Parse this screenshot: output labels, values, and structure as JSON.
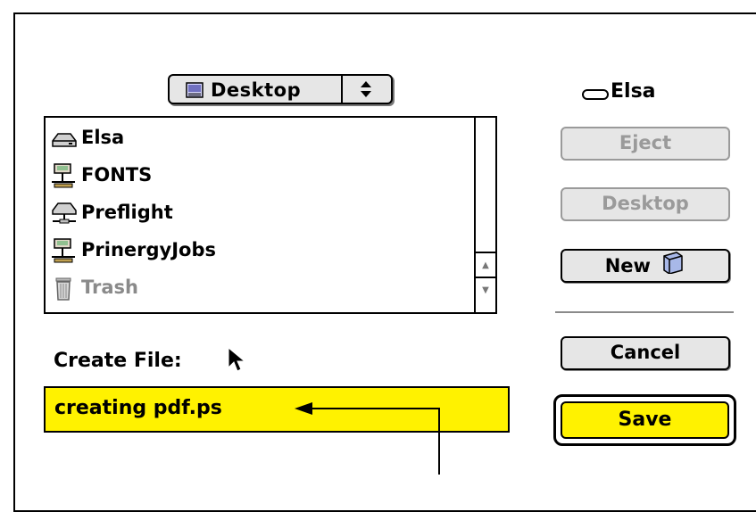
{
  "popup": {
    "label": "Desktop",
    "icon": "desktop-icon"
  },
  "volume": {
    "name": "Elsa",
    "icon": "hard-disk-icon"
  },
  "file_list": {
    "items": [
      {
        "name": "Elsa",
        "icon": "hard-disk-icon",
        "enabled": true
      },
      {
        "name": "FONTS",
        "icon": "network-volume-icon",
        "enabled": true
      },
      {
        "name": "Preflight",
        "icon": "server-icon",
        "enabled": true
      },
      {
        "name": "PrinergyJobs",
        "icon": "network-volume-icon",
        "enabled": true
      },
      {
        "name": "Trash",
        "icon": "trash-icon",
        "enabled": false
      }
    ]
  },
  "buttons": {
    "eject": "Eject",
    "desktop": "Desktop",
    "new": "New",
    "cancel": "Cancel",
    "save": "Save"
  },
  "create_file": {
    "label": "Create File:",
    "value": "creating pdf.ps"
  },
  "colors": {
    "highlight": "#fff200",
    "button_face": "#e6e6e6",
    "disabled_text": "#9a9a9a"
  }
}
